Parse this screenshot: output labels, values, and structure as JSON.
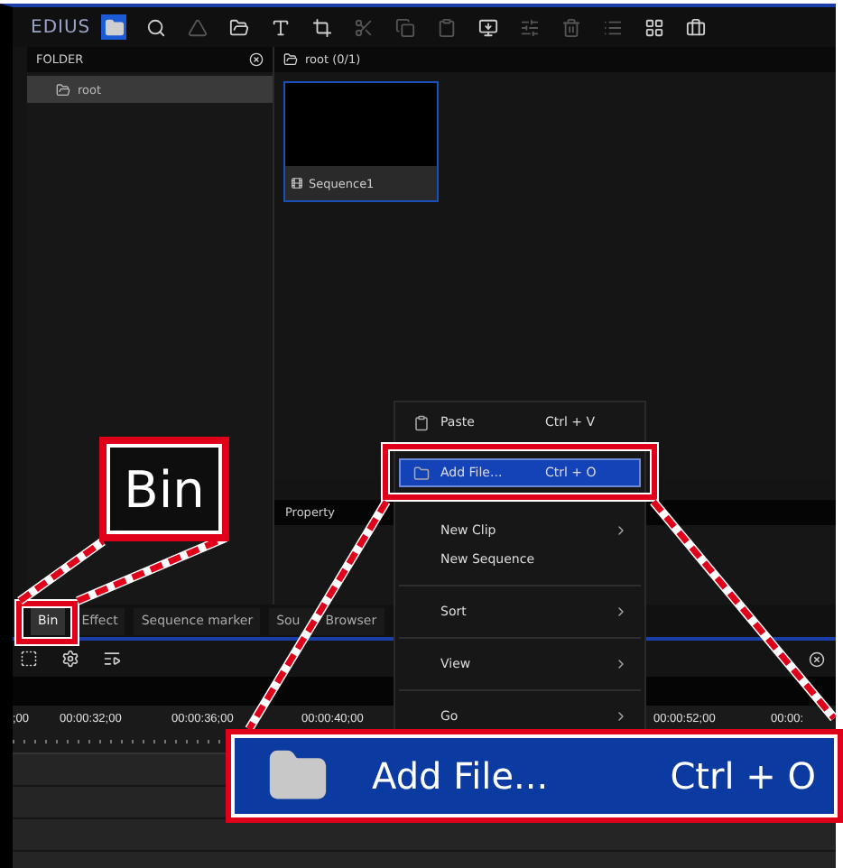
{
  "toolbar": {
    "logo": "EDIUS"
  },
  "folder_panel": {
    "title": "FOLDER",
    "items": [
      {
        "label": "root",
        "selected": true
      }
    ]
  },
  "bin_panel": {
    "path": "root (0/1)",
    "clips": [
      {
        "name": "Sequence1",
        "selected": true
      }
    ]
  },
  "property_panel": {
    "title": "Property"
  },
  "tabs": [
    {
      "label": "Bin",
      "selected": true
    },
    {
      "label": "Effect",
      "selected": false
    },
    {
      "label": "Sequence marker",
      "selected": false
    },
    {
      "label": "Sou",
      "label_continued": "Browser",
      "selected": false
    }
  ],
  "timeline": {
    "timecodes": [
      ";00",
      "00:00:32;00",
      "00:00:36;00",
      "00:00:40;00",
      "00:00:52;00",
      "00:00:"
    ]
  },
  "context_menu": {
    "items": [
      {
        "kind": "item",
        "label": "Paste",
        "shortcut": "Ctrl + V",
        "submenu": false,
        "selected": false
      },
      {
        "kind": "item",
        "label": "Add File...",
        "shortcut": "Ctrl + O",
        "submenu": false,
        "selected": true
      },
      {
        "kind": "item",
        "label": "New Clip",
        "submenu": true,
        "selected": false
      },
      {
        "kind": "item",
        "label": "New Sequence",
        "submenu": false,
        "selected": false
      },
      {
        "kind": "separator"
      },
      {
        "kind": "item",
        "label": "Sort",
        "submenu": true,
        "selected": false
      },
      {
        "kind": "separator"
      },
      {
        "kind": "item",
        "label": "View",
        "submenu": true,
        "selected": false
      },
      {
        "kind": "separator"
      },
      {
        "kind": "item",
        "label": "Go",
        "submenu": true,
        "selected": false
      }
    ]
  },
  "callouts": {
    "bin": {
      "label": "Bin"
    },
    "add_file": {
      "label": "Add File...",
      "shortcut": "Ctrl + O"
    }
  }
}
